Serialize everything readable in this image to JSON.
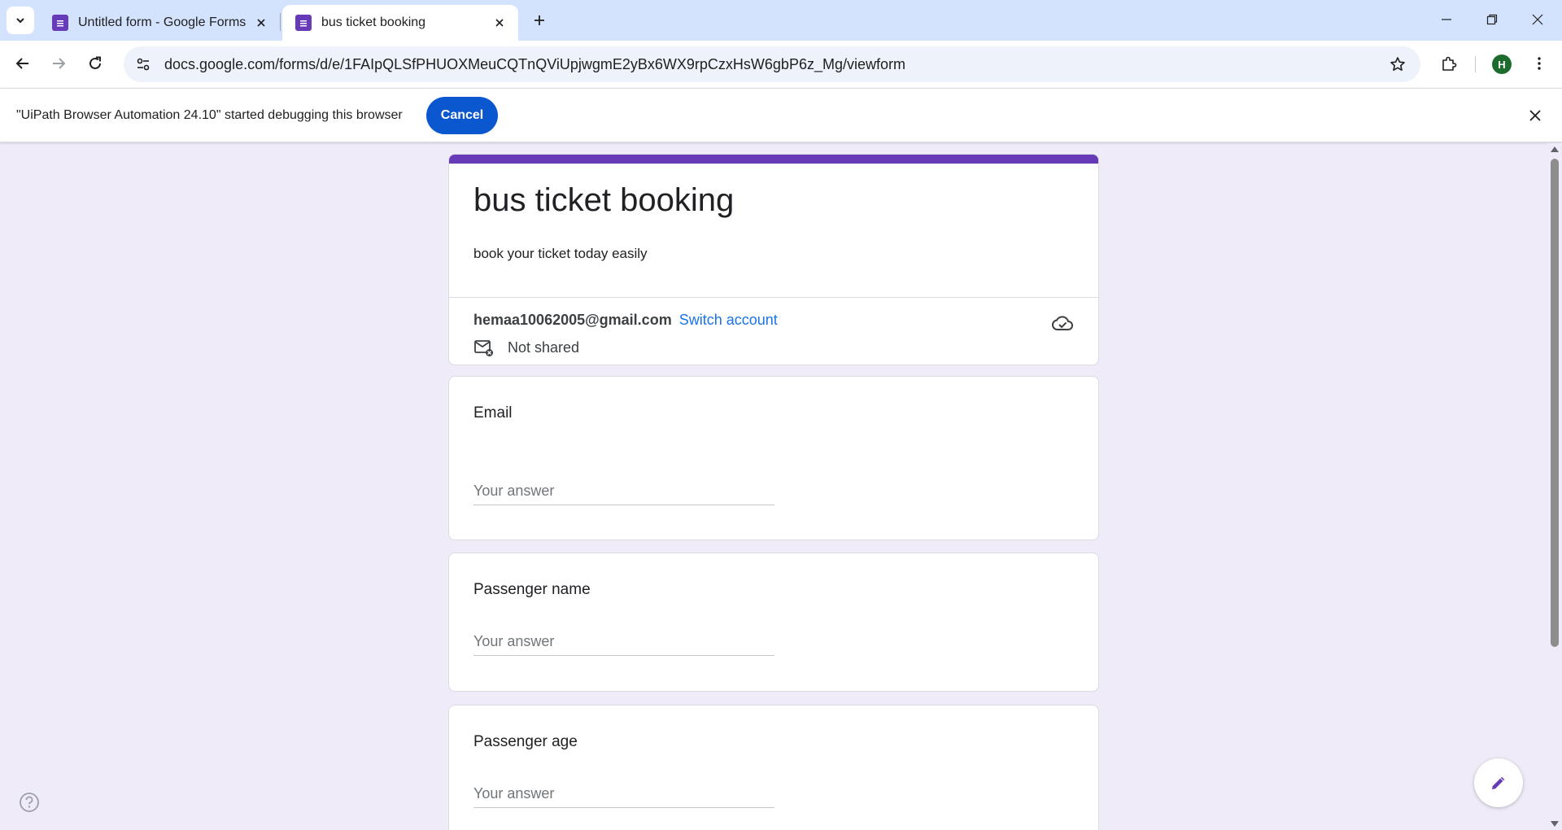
{
  "browser": {
    "tabs": [
      {
        "title": "Untitled form - Google Forms",
        "active": false
      },
      {
        "title": "bus ticket booking",
        "active": true
      }
    ],
    "url": "docs.google.com/forms/d/e/1FAIpQLSfPHUOXMeuCQTnQViUpjwgmE2yBx6WX9rpCzxHsW6gbP6z_Mg/viewform",
    "profile_initial": "H",
    "accent_color": "#d3e3fd"
  },
  "infobar": {
    "message": "\"UiPath Browser Automation 24.10\" started debugging this browser",
    "cancel_label": "Cancel"
  },
  "form": {
    "title": "bus ticket booking",
    "description": "book your ticket today easily",
    "theme_color": "#673ab7",
    "account_email": "hemaa10062005@gmail.com",
    "switch_account_label": "Switch account",
    "not_shared_label": "Not shared",
    "questions": [
      {
        "label": "Email",
        "placeholder": "Your answer"
      },
      {
        "label": "Passenger name",
        "placeholder": "Your answer"
      },
      {
        "label": "Passenger age",
        "placeholder": "Your answer"
      }
    ]
  }
}
